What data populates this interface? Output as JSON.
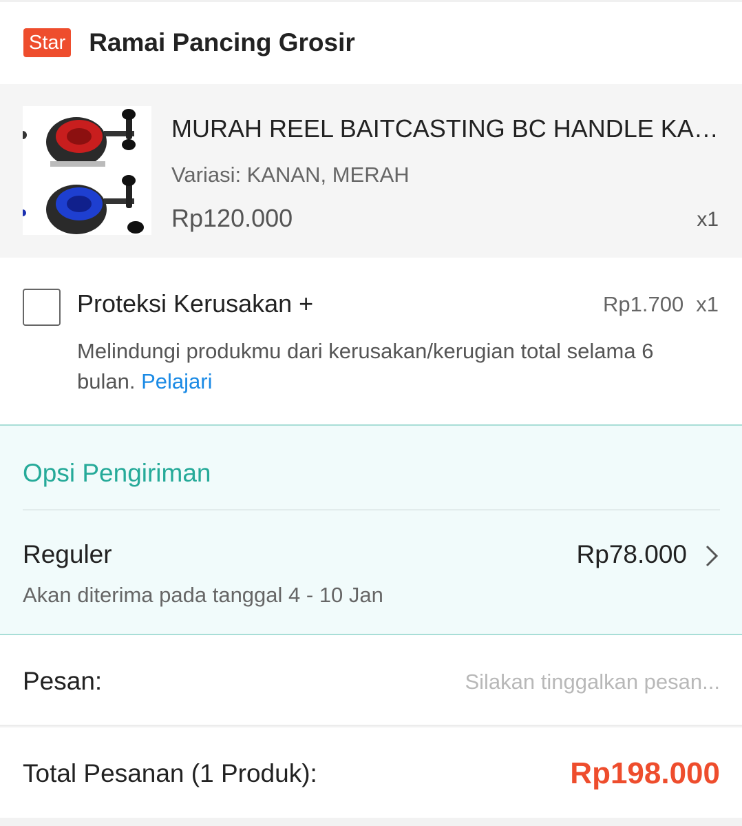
{
  "shop": {
    "badge": "Star",
    "name": "Ramai Pancing Grosir"
  },
  "product": {
    "title": "MURAH REEL BAITCASTING BC HANDLE KANAN",
    "variant": "Variasi: KANAN, MERAH",
    "price": "Rp120.000",
    "quantity": "x1"
  },
  "protection": {
    "title": "Proteksi Kerusakan +",
    "price": "Rp1.700",
    "quantity": "x1",
    "description": "Melindungi produkmu dari kerusakan/kerugian total selama 6 bulan.",
    "learn_link": "Pelajari",
    "checked": false
  },
  "shipping": {
    "heading": "Opsi Pengiriman",
    "method": "Reguler",
    "price": "Rp78.000",
    "eta": "Akan diterima pada tanggal 4 - 10 Jan"
  },
  "message": {
    "label": "Pesan:",
    "placeholder": "Silakan tinggalkan pesan..."
  },
  "total": {
    "label": "Total Pesanan (1 Produk):",
    "value": "Rp198.000"
  },
  "colors": {
    "accent": "#ee4d2d",
    "shipping_teal": "#26aa99",
    "link": "#1a8ae5"
  }
}
